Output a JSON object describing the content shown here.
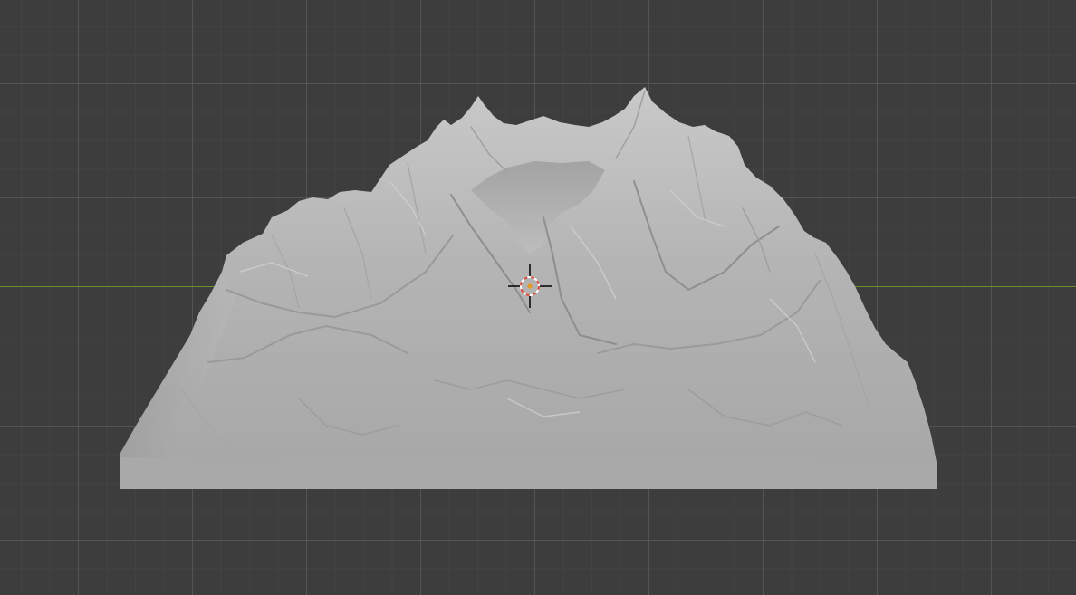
{
  "viewport": {
    "background_color": "#3d3d3d",
    "grid_major_color": "#565656",
    "grid_minor_color": "#464646",
    "x_axis_color": "#6b8f2b"
  },
  "scene": {
    "object": "terrain-mesh",
    "material_color": "#b3b3b3",
    "shading": "solid"
  },
  "cursor": {
    "icon": "3d-cursor-icon",
    "ring_color_a": "#d94a3a",
    "ring_color_b": "#ffffff",
    "center_color": "#e39a2a"
  }
}
